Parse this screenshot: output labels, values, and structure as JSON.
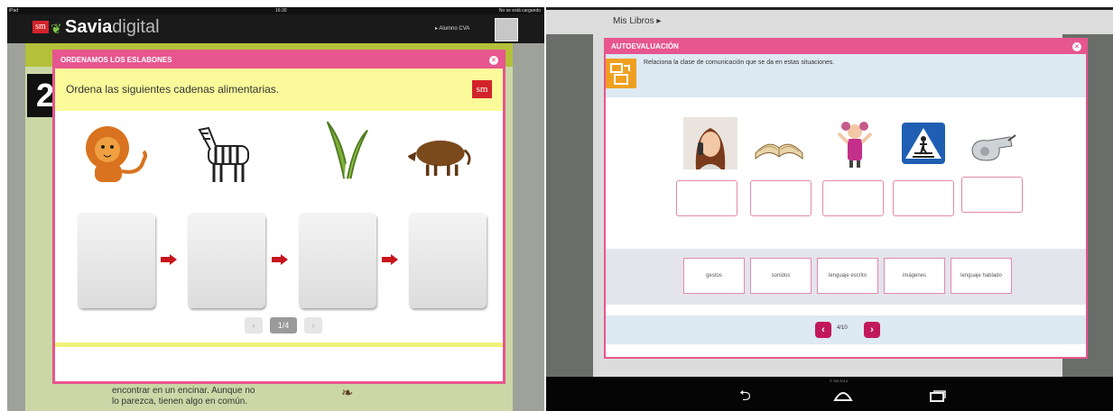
{
  "left_screen": {
    "status": {
      "device": "iPad",
      "time": "16:30",
      "charging": "No se está cargando"
    },
    "app": {
      "brand_bold": "Savia",
      "brand_light": "digital",
      "sm": "sm",
      "user": "▸ Alumno CVA"
    },
    "book": {
      "unit_number": "2",
      "text_line1": "encontrar en un encinar. Aunque no",
      "text_line2": "lo parezca, tienen algo en común."
    },
    "modal": {
      "title": "ORDENAMOS LOS ESLABONES",
      "close": "×",
      "instruction": "Ordena las siguientes cadenas alimentarias.",
      "badge": "sm",
      "animals": [
        "lion-icon",
        "zebra-icon",
        "grass-icon",
        "boar-icon"
      ],
      "pager": {
        "prev": "‹",
        "page": "1/4",
        "next": "›"
      }
    }
  },
  "right_screen": {
    "breadcrumb": "Mis Libros ▸",
    "modal": {
      "title": "AUTOEVALUACIÓN",
      "close": "×",
      "instruction": "Relaciona la clase de comunicación que se da en estas situaciones.",
      "pictures": [
        "phone-woman-icon",
        "open-book-icon",
        "gesturing-girl-icon",
        "crosswalk-sign-icon",
        "whistle-icon"
      ],
      "options": [
        "gestos",
        "sonidos",
        "lenguaje escrito",
        "imágenes",
        "lenguaje hablado"
      ],
      "pager": {
        "prev": "‹",
        "page": "4/10",
        "next": "›"
      }
    },
    "footer_copyright": "© SM 2014"
  },
  "colors": {
    "accent": "#e7568e",
    "instruction_yellow": "#fafa9b",
    "instruction_blue": "#dde9f3",
    "nav_button": "#c2185b"
  }
}
